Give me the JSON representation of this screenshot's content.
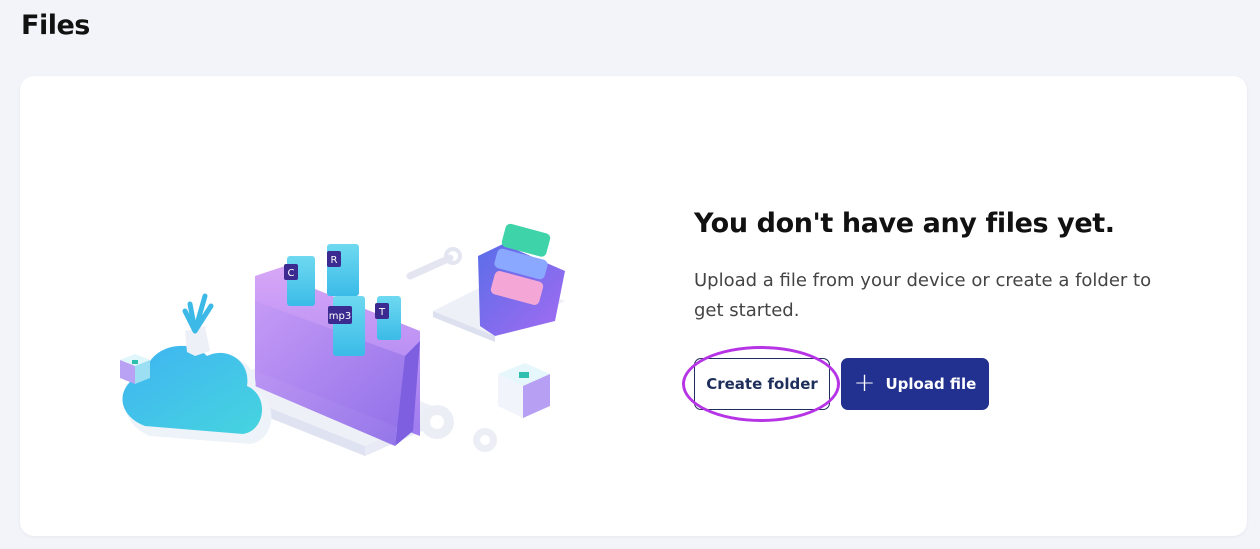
{
  "page": {
    "title": "Files"
  },
  "empty_state": {
    "title": "You don't have any files yet.",
    "description": "Upload a file from your device or create a folder to get started."
  },
  "actions": {
    "create_folder_label": "Create folder",
    "upload_label": "Upload file",
    "upload_icon": "plus-icon"
  },
  "illustration": {
    "file_tags": [
      "C",
      "R",
      "mp3",
      "T"
    ]
  },
  "colors": {
    "background": "#f3f4f9",
    "card": "#ffffff",
    "primary": "#22318f",
    "outline_text": "#1e2f5c",
    "highlight": "#b633e6"
  }
}
